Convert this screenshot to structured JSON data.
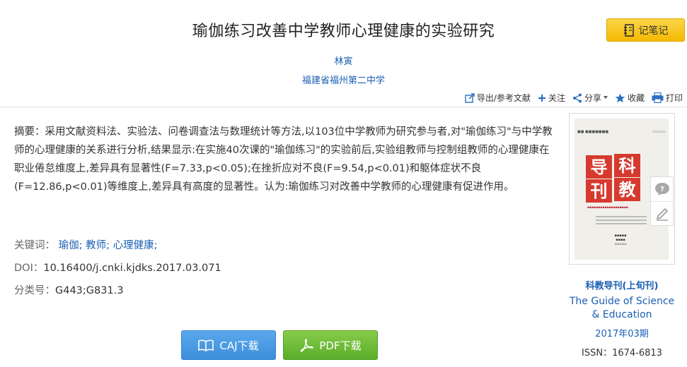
{
  "article": {
    "title": "瑜伽练习改善中学教师心理健康的实验研究",
    "author": "林寅",
    "organization": "福建省福州第二中学",
    "abstract": "摘要：采用文献资料法、实验法、问卷调查法与数理统计等方法,以103位中学教师为研究参与者,对\"瑜伽练习\"与中学教师的心理健康的关系进行分析,结果显示:在实施40次课的\"瑜伽练习\"的实验前后,实验组教师与控制组教师的心理健康在职业倦怠维度上,差异具有显著性(F=7.33,p<0.05);在挫折应对不良(F=9.54,p<0.01)和躯体症状不良(F=12.86,p<0.01)等维度上,差异具有高度的显著性。认为:瑜伽练习对改善中学教师的心理健康有促进作用。",
    "keywords_label": "关键词：",
    "keywords": [
      "瑜伽;",
      "教师;",
      "心理健康;"
    ],
    "doi_label": "DOI：",
    "doi": "10.16400/j.cnki.kjdks.2017.03.071",
    "class_label": "分类号：",
    "class_code": "G443;G831.3"
  },
  "toolbar": {
    "note_label": "记笔记",
    "export_label": "导出/参考文献",
    "follow_label": "关注",
    "share_label": "分享",
    "favorite_label": "收藏",
    "print_label": "打印"
  },
  "downloads": {
    "caj_label": "CAJ下载",
    "pdf_label": "PDF下载"
  },
  "journal": {
    "name": "科教导刊(上旬刊)",
    "english_name": "The Guide of Science & Education",
    "issue": "2017年03期",
    "issn": "ISSN：1674-6813",
    "cover_tiles": [
      "导",
      "科",
      "刊",
      "教"
    ]
  },
  "colors": {
    "link": "#1a5fb4",
    "note_button": "#f4b900",
    "caj_button": "#3d8fdc",
    "pdf_button": "#5aad2a",
    "cover_red": "#d63a2f"
  }
}
